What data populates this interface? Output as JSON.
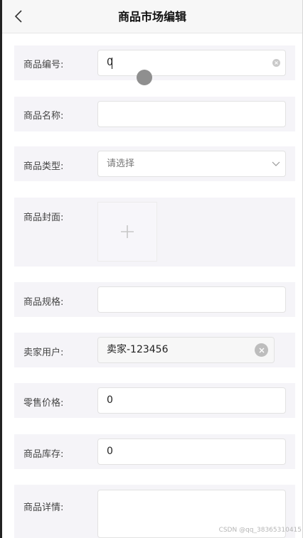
{
  "header": {
    "title": "商品市场编辑"
  },
  "form": {
    "product_number": {
      "label": "商品编号:",
      "value": "0"
    },
    "product_name": {
      "label": "商品名称:",
      "value": ""
    },
    "product_type": {
      "label": "商品类型:",
      "placeholder": "请选择"
    },
    "cover": {
      "label": "商品封面:"
    },
    "spec": {
      "label": "商品规格:",
      "value": ""
    },
    "seller": {
      "label": "卖家用户:",
      "value": "卖家-123456"
    },
    "retail_price": {
      "label": "零售价格:",
      "value": "0"
    },
    "stock": {
      "label": "商品库存:",
      "value": "0"
    },
    "detail": {
      "label": "商品详情:",
      "value": ""
    }
  },
  "icons": {
    "back": "chevron-left-icon",
    "clear": "clear-icon",
    "dropdown": "chevron-down-icon",
    "upload": "plus-icon"
  },
  "watermark": "CSDN @qq_38365310415"
}
